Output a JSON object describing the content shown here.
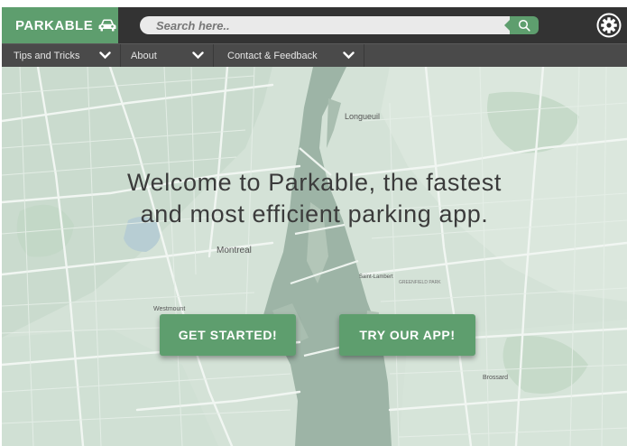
{
  "header": {
    "brand": "PARKABLE",
    "brand_icon": "car-icon",
    "search_placeholder": "Search here..",
    "search_icon": "search-icon",
    "settings_icon": "gear-icon"
  },
  "nav": {
    "items": [
      {
        "label": "Tips and Tricks",
        "icon": "chevron-down-icon"
      },
      {
        "label": "About",
        "icon": "chevron-down-icon"
      },
      {
        "label": "Contact & Feedback",
        "icon": "chevron-down-icon"
      }
    ]
  },
  "map": {
    "labels": {
      "longueuil": "Longueuil",
      "montreal": "Montreal",
      "brossard": "Brossard",
      "westmount": "Westmount",
      "saint_lambert": "Saint-Lambert",
      "greenfield_park": "GREENFIELD PARK"
    }
  },
  "hero": {
    "line1": "Welcome to Parkable, the fastest",
    "line2": "and most efficient parking app."
  },
  "actions": {
    "get_started": "GET STARTED!",
    "try_app": "TRY OUR APP!"
  },
  "colors": {
    "brand_green": "#5e9e6e",
    "header_bg": "#333333",
    "nav_bg": "#4a4a4a"
  }
}
